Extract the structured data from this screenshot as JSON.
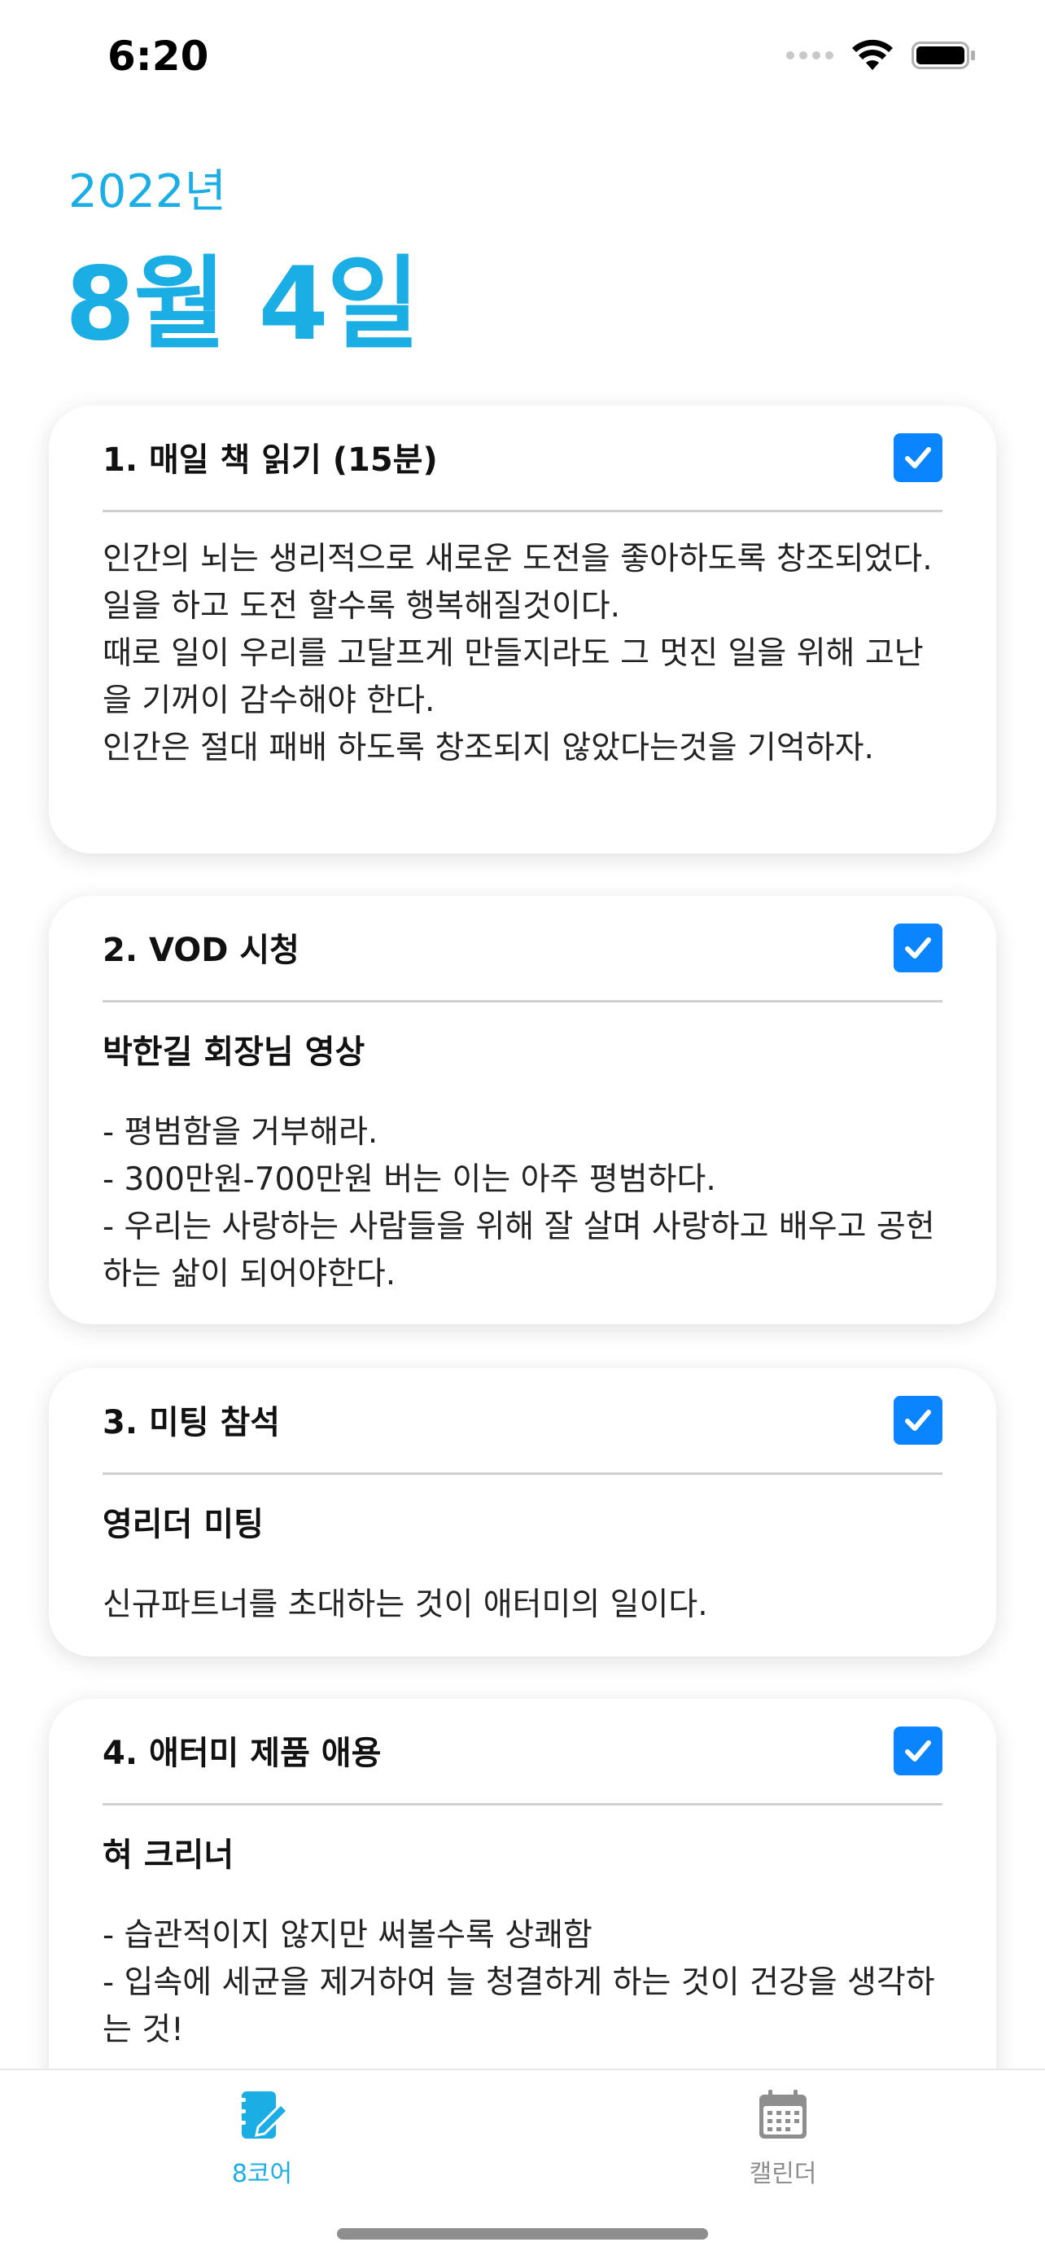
{
  "status_bar": {
    "time": "6:20"
  },
  "date": {
    "year": "2022년",
    "main": "8월 4일"
  },
  "colors": {
    "accent": "#1aaee5",
    "checkbox": "#0a84ff",
    "tab_inactive": "#8e8e8e"
  },
  "cards": [
    {
      "title": "1. 매일 책 읽기 (15분)",
      "checked": true,
      "subtitle": "",
      "text": "인간의 뇌는 생리적으로 새로운 도전을 좋아하도록 창조되었다.\n일을 하고 도전 할수록 행복해질것이다.\n때로 일이 우리를 고달프게 만들지라도 그 멋진 일을 위해 고난을 기꺼이 감수해야 한다.\n인간은 절대 패배 하도록 창조되지 않았다는것을 기억하자."
    },
    {
      "title": "2. VOD 시청",
      "checked": true,
      "subtitle": "박한길 회장님 영상",
      "text": "- 평범함을 거부해라.\n- 300만원-700만원 버는 이는 아주 평범하다.\n- 우리는 사랑하는 사람들을 위해 잘 살며 사랑하고 배우고 공헌하는 삶이 되어야한다."
    },
    {
      "title": "3. 미팅 참석",
      "checked": true,
      "subtitle": "영리더 미팅",
      "text": "신규파트너를 초대하는 것이 애터미의 일이다."
    },
    {
      "title": "4. 애터미 제품 애용",
      "checked": true,
      "subtitle": "혀 크리너",
      "text": "- 습관적이지 않지만 써볼수록 상쾌함\n- 입속에 세균을 제거하여 늘 청결하게 하는 것이 건강을 생각하는 것!"
    }
  ],
  "tabs": [
    {
      "label": "8코어",
      "icon": "notebook-pencil-icon",
      "active": true
    },
    {
      "label": "캘린더",
      "icon": "calendar-icon",
      "active": false
    }
  ]
}
